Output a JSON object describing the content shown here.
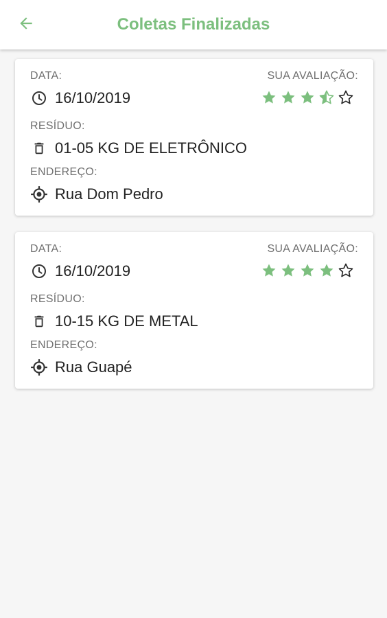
{
  "appbar": {
    "title": "Coletas Finalizadas",
    "back_icon": "arrow-left-icon",
    "accent_color": "#7cbf7e"
  },
  "labels": {
    "date": "DATA:",
    "rating": "SUA AVALIAÇÃO:",
    "waste": "RESÍDUO:",
    "address": "ENDEREÇO:"
  },
  "collections": [
    {
      "date": "16/10/2019",
      "rating": 3.5,
      "rating_max": 5,
      "waste": "01-05 KG DE ELETRÔNICO",
      "address": "Rua Dom Pedro"
    },
    {
      "date": "16/10/2019",
      "rating": 4,
      "rating_max": 5,
      "waste": "10-15 KG DE METAL",
      "address": "Rua Guapé"
    }
  ],
  "icons": {
    "date": "clock-icon",
    "waste": "trash-icon",
    "address": "location-target-icon",
    "star_full": "star-filled-icon",
    "star_half": "star-half-icon",
    "star_empty": "star-outline-icon"
  }
}
